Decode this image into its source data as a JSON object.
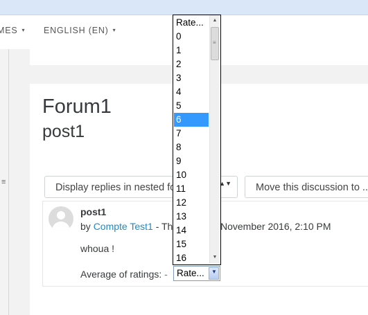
{
  "nav": {
    "items": [
      {
        "label": "MES",
        "caret": "▾"
      },
      {
        "label": "ENGLISH (EN)",
        "caret": "▾"
      }
    ]
  },
  "drawer": {
    "handle": "≡"
  },
  "page": {
    "title": "Forum1",
    "discussion_title": "post1"
  },
  "controls": {
    "display_mode": "Display replies in nested fo",
    "updown": "▲▼",
    "move_discussion": "Move this discussion to ..."
  },
  "post": {
    "subject": "post1",
    "by_prefix": "by ",
    "author": "Compte Test1",
    "date_left": " - Th",
    "date_right": "November 2016, 2:10 PM",
    "body": "whoua !",
    "ratings_label": "Average of ratings: ",
    "ratings_value": "-"
  },
  "rate_select": {
    "value": "Rate...",
    "options": [
      "Rate...",
      "0",
      "1",
      "2",
      "3",
      "4",
      "5",
      "6",
      "7",
      "8",
      "9",
      "10",
      "11",
      "12",
      "13",
      "14",
      "15",
      "16"
    ],
    "highlighted": "6"
  },
  "scroll": {
    "up": "▲",
    "down": "▼",
    "grip": "≡"
  },
  "colors": {
    "accent_link": "#1e8bc3",
    "highlight": "#3399ff",
    "top_strip": "#d9e7f8"
  }
}
